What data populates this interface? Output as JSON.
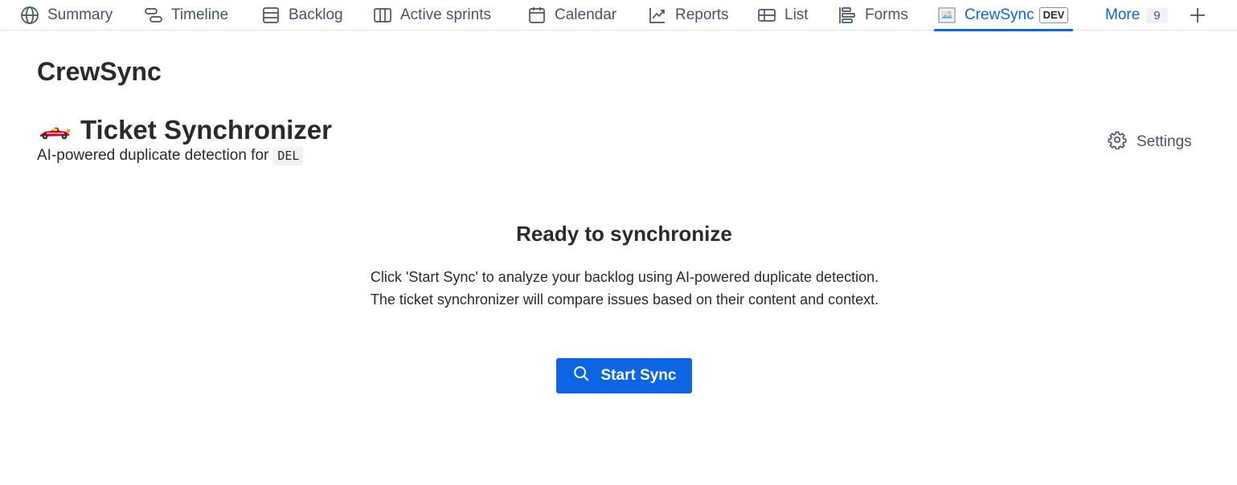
{
  "tabs": {
    "summary": "Summary",
    "timeline": "Timeline",
    "backlog": "Backlog",
    "active_sprints": "Active sprints",
    "calendar": "Calendar",
    "reports": "Reports",
    "list": "List",
    "forms": "Forms",
    "crewsync": "CrewSync",
    "crewsync_badge": "DEV",
    "more": "More",
    "more_count": "9"
  },
  "icons": {
    "summary": "globe-icon",
    "timeline": "timeline-icon",
    "backlog": "backlog-icon",
    "active_sprints": "board-columns-icon",
    "calendar": "calendar-icon",
    "reports": "line-chart-icon",
    "list": "table-list-icon",
    "forms": "forms-icon",
    "crewsync": "app-image-icon",
    "add": "plus-icon",
    "heading": "race-car-icon",
    "settings": "gear-icon",
    "start": "search-icon"
  },
  "app": {
    "title": "CrewSync"
  },
  "page": {
    "heading": "Ticket Synchronizer",
    "subtitle": "AI-powered duplicate detection for",
    "project_key": "DEL",
    "settings_label": "Settings"
  },
  "empty_state": {
    "title": "Ready to synchronize",
    "description": "Click 'Start Sync' to analyze your backlog using AI-powered duplicate detection. The ticket synchronizer will compare issues based on their content and context.",
    "button_label": "Start Sync"
  },
  "colors": {
    "accent": "#0c66e4",
    "text": "#292a2e",
    "subtle_text": "#44546f",
    "border": "#dcdfe4"
  }
}
